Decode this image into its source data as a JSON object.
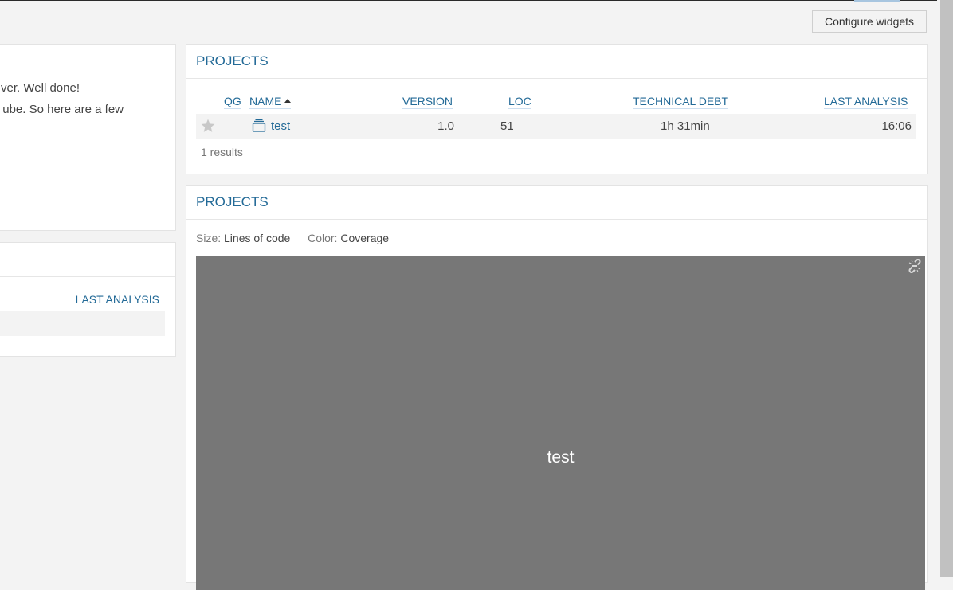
{
  "toolbar": {
    "configure_widgets": "Configure widgets"
  },
  "welcome_widget": {
    "lines": [
      "ver. Well done!",
      "ube. So here are a few"
    ]
  },
  "my_projects_widget": {
    "columns": [
      "LAST ANALYSIS"
    ]
  },
  "projects_table_widget": {
    "title": "PROJECTS",
    "columns": {
      "qg": "QG",
      "name": "NAME",
      "version": "VERSION",
      "loc": "LOC",
      "technical_debt": "TECHNICAL DEBT",
      "last_analysis": "LAST ANALYSIS"
    },
    "sort": {
      "column": "name",
      "direction": "ascending"
    },
    "rows": [
      {
        "favorite": false,
        "qualifier_icon": "project-icon",
        "name": "test",
        "version": "1.0",
        "loc": "51",
        "technical_debt": "1h 31min",
        "last_analysis": "16:06"
      }
    ],
    "results_text": "1 results"
  },
  "projects_treemap_widget": {
    "title": "PROJECTS",
    "size_label": "Size:",
    "size_metric": "Lines of code",
    "color_label": "Color:",
    "color_metric": "Coverage",
    "cells": [
      {
        "label": "test",
        "color": "#777777"
      }
    ],
    "icons": {
      "unlink": "broken-link-icon"
    }
  }
}
